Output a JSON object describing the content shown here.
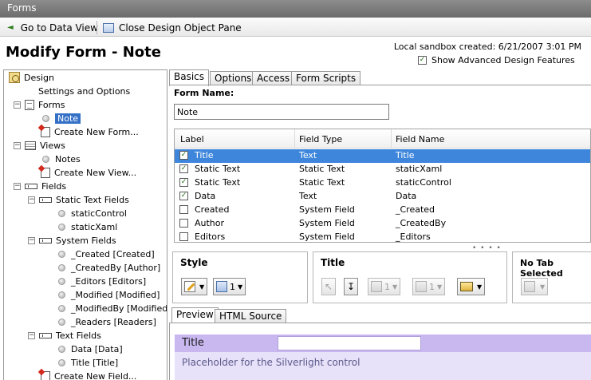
{
  "window": {
    "title": "Forms"
  },
  "toolbar": {
    "go_to_data_view": "Go to Data View",
    "close_pane": "Close Design Object Pane"
  },
  "header": {
    "title": "Modify Form - Note",
    "sandbox": "Local sandbox created: 6/21/2007 3:01 PM",
    "show_advanced": "Show Advanced Design Features",
    "show_advanced_checked": true
  },
  "tree": {
    "design": "Design",
    "settings": "Settings and Options",
    "forms": "Forms",
    "form_note": "Note",
    "create_form": "Create New Form...",
    "views": "Views",
    "view_notes": "Notes",
    "create_view": "Create New View...",
    "fields": "Fields",
    "static_text_fields": "Static Text Fields",
    "static_control": "staticControl",
    "static_xaml": "staticXaml",
    "system_fields": "System Fields",
    "sys_created": "_Created [Created]",
    "sys_createdby": "_CreatedBy [Author]",
    "sys_editors": "_Editors [Editors]",
    "sys_modified": "_Modified [Modified]",
    "sys_modifiedby": "_ModifiedBy [Modified B",
    "sys_readers": "_Readers [Readers]",
    "text_fields": "Text Fields",
    "tf_data": "Data [Data]",
    "tf_title": "Title [Title]",
    "create_field": "Create New Field..."
  },
  "tabs": {
    "basics": "Basics",
    "options": "Options",
    "access": "Access",
    "scripts": "Form Scripts"
  },
  "form": {
    "name_label": "Form Name:",
    "name_value": "Note"
  },
  "grid": {
    "columns": [
      "Label",
      "Field Type",
      "Field Name"
    ],
    "rows": [
      {
        "checked": true,
        "label": "Title",
        "type": "Text",
        "name": "Title",
        "selected": true
      },
      {
        "checked": true,
        "label": "Static Text",
        "type": "Static Text",
        "name": "staticXaml"
      },
      {
        "checked": true,
        "label": "Static Text",
        "type": "Static Text",
        "name": "staticControl"
      },
      {
        "checked": true,
        "label": "Data",
        "type": "Text",
        "name": "Data"
      },
      {
        "checked": false,
        "label": "Created",
        "type": "System Field",
        "name": "_Created"
      },
      {
        "checked": false,
        "label": "Author",
        "type": "System Field",
        "name": "_CreatedBy"
      },
      {
        "checked": false,
        "label": "Editors",
        "type": "System Field",
        "name": "_Editors"
      }
    ]
  },
  "panels": {
    "style": "Style",
    "style_cols": "1",
    "title": "Title",
    "title_cols_a": "1",
    "title_cols_b": "1",
    "no_tab": "No Tab Selected"
  },
  "preview": {
    "tab_preview": "Preview",
    "tab_html": "HTML Source",
    "title_label": "Title",
    "placeholder": "Placeholder for the Silverlight control"
  },
  "colors": {
    "selection": "#3d86dc",
    "preview_title": "#c9b8f0",
    "preview_band": "#e8e1fa"
  }
}
